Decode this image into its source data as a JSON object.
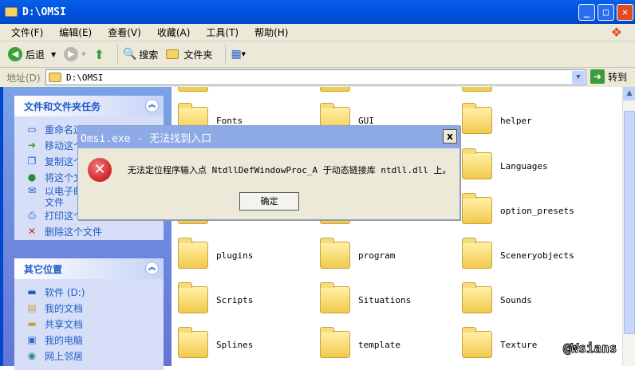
{
  "window": {
    "title": "D:\\OMSI",
    "minimize": "_",
    "maximize": "□",
    "close": "✕"
  },
  "menu": [
    "文件(F)",
    "编辑(E)",
    "查看(V)",
    "收藏(A)",
    "工具(T)",
    "帮助(H)"
  ],
  "toolbar": {
    "back": "后退",
    "search": "搜索",
    "folders": "文件夹"
  },
  "address": {
    "label": "地址(D)",
    "value": "D:\\OMSI",
    "go": "转到"
  },
  "tasks": {
    "title": "文件和文件夹任务",
    "items": [
      "重命名这个文件",
      "移动这个文件",
      "复制这个文件",
      "将这个文件发布到 Web",
      "以电子邮件形式发送此",
      "文件",
      "打印这个文件",
      "删除这个文件"
    ]
  },
  "places": {
    "title": "其它位置",
    "items": [
      "软件 (D:)",
      "我的文档",
      "共享文档",
      "我的电脑",
      "网上邻居"
    ]
  },
  "folders": [
    [
      "Fonts",
      "GUI",
      "helper"
    ],
    [
      "",
      "",
      "Languages"
    ],
    [
      "",
      "",
      "option_presets"
    ],
    [
      "plugins",
      "program",
      "Sceneryobjects"
    ],
    [
      "Scripts",
      "Situations",
      "Sounds"
    ],
    [
      "Splines",
      "template",
      "Texture"
    ]
  ],
  "dialog": {
    "title": "Omsi.exe - 无法找到入口",
    "message": "无法定位程序输入点 NtdllDefWindowProc_A 于动态链接库 ntdll.dll 上。",
    "ok": "确定",
    "close": "x"
  },
  "watermark": "@Wsians"
}
